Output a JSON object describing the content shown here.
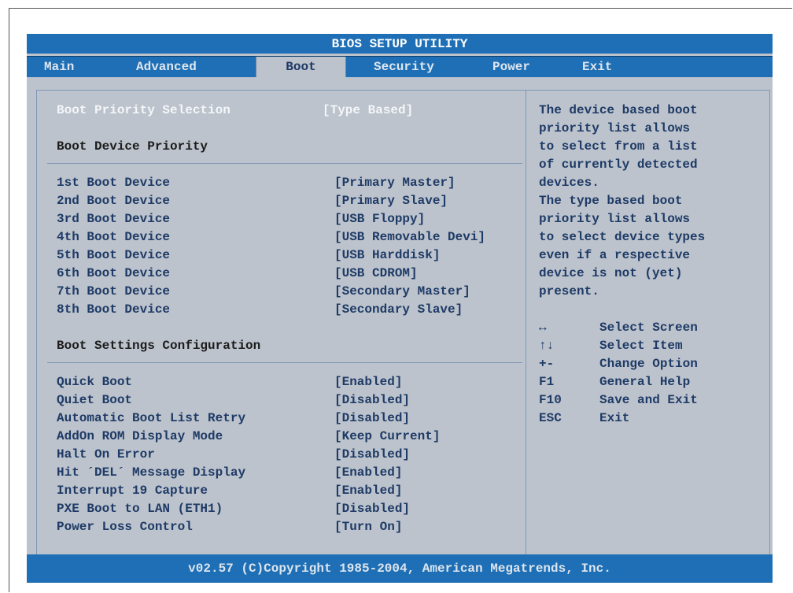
{
  "title": "BIOS SETUP UTILITY",
  "tabs": [
    {
      "label": "Main"
    },
    {
      "label": "Advanced"
    },
    {
      "label": "Boot"
    },
    {
      "label": "Security"
    },
    {
      "label": "Power"
    },
    {
      "label": "Exit"
    }
  ],
  "active_tab": "Boot",
  "boot_priority": {
    "label": "Boot Priority Selection",
    "value": "[Type Based]"
  },
  "sections": {
    "device_priority": "Boot Device Priority",
    "settings": "Boot Settings Configuration"
  },
  "boot_devices": [
    {
      "label": "1st Boot Device",
      "value": "[Primary Master]"
    },
    {
      "label": "2nd Boot Device",
      "value": "[Primary Slave]"
    },
    {
      "label": "3rd Boot Device",
      "value": "[USB Floppy]"
    },
    {
      "label": "4th Boot Device",
      "value": "[USB Removable Devi]"
    },
    {
      "label": "5th Boot Device",
      "value": "[USB Harddisk]"
    },
    {
      "label": "6th Boot Device",
      "value": "[USB CDROM]"
    },
    {
      "label": "7th Boot Device",
      "value": "[Secondary Master]"
    },
    {
      "label": "8th Boot Device",
      "value": "[Secondary Slave]"
    }
  ],
  "boot_settings": [
    {
      "label": "Quick Boot",
      "value": "[Enabled]"
    },
    {
      "label": "Quiet Boot",
      "value": "[Disabled]"
    },
    {
      "label": "Automatic Boot List Retry",
      "value": "[Disabled]"
    },
    {
      "label": "AddOn ROM Display Mode",
      "value": "[Keep Current]"
    },
    {
      "label": "Halt On Error",
      "value": "[Disabled]"
    },
    {
      "label": "Hit ´DEL´ Message Display",
      "value": "[Enabled]"
    },
    {
      "label": "Interrupt 19 Capture",
      "value": "[Enabled]"
    },
    {
      "label": "PXE Boot to LAN (ETH1)",
      "value": "[Disabled]"
    },
    {
      "label": "Power Loss Control",
      "value": "[Turn On]"
    }
  ],
  "help_text": [
    "The device based boot",
    "priority list allows",
    "to select from a list",
    "of currently detected",
    "devices.",
    "The type based boot",
    "priority list allows",
    "to select device types",
    "even if a respective",
    "device is not (yet)",
    "present."
  ],
  "keys": [
    {
      "key": "↔",
      "icon": "left-right-arrow-icon",
      "desc": "Select Screen"
    },
    {
      "key": "↑↓",
      "icon": "up-down-arrow-icon",
      "desc": "Select Item"
    },
    {
      "key": "+-",
      "icon": "plus-minus-icon",
      "desc": "Change Option"
    },
    {
      "key": "F1",
      "icon": "",
      "desc": "General Help"
    },
    {
      "key": "F10",
      "icon": "",
      "desc": "Save and Exit"
    },
    {
      "key": "ESC",
      "icon": "",
      "desc": "Exit"
    }
  ],
  "footer": "v02.57 (C)Copyright 1985-2004, American Megatrends, Inc.",
  "colors": {
    "bar_blue": "#1e6fb5",
    "panel_gray": "#bcc3cc",
    "text_navy": "#1e3a66",
    "highlight_white": "#f4f6f9"
  }
}
